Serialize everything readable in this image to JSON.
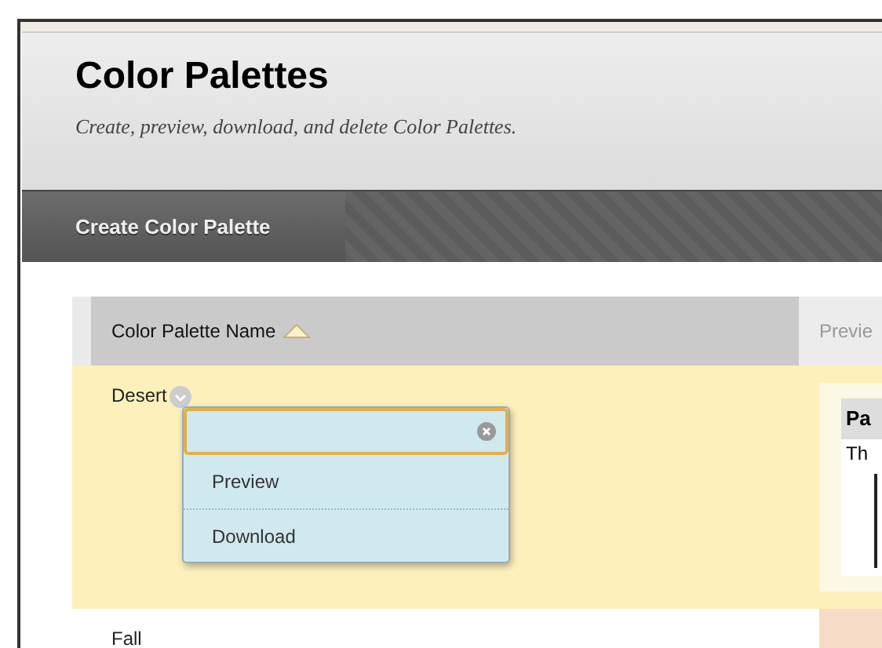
{
  "page": {
    "title": "Color Palettes",
    "subtitle": "Create, preview, download, and delete Color Palettes."
  },
  "action_bar": {
    "buttons": [
      "Create Color Palette"
    ]
  },
  "table": {
    "columns": [
      {
        "label": "Color Palette Name",
        "sorted": true
      },
      {
        "label": "Previe",
        "sorted": false
      }
    ],
    "rows": [
      {
        "name": "Desert",
        "selected": true,
        "preview": {
          "title": "Pa",
          "text": "Th"
        }
      },
      {
        "name": "Fall",
        "selected": false
      }
    ]
  },
  "context_menu": {
    "items": [
      "Preview",
      "Download"
    ]
  }
}
